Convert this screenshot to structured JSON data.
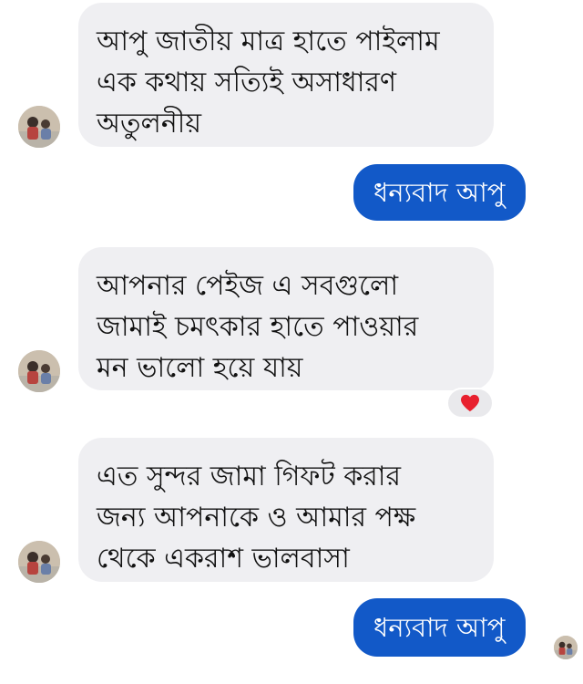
{
  "colors": {
    "incoming_bubble": "#efeff2",
    "outgoing_bubble": "#1259c8",
    "reaction_heart": "#e8202e"
  },
  "messages": [
    {
      "direction": "incoming",
      "lines": [
        "আপু জাতীয় মাত্র হাতে পাইলাম",
        "এক কথায় সত্যিই অসাধারণ",
        "অতুলনীয়"
      ]
    },
    {
      "direction": "outgoing",
      "text": "ধন্যবাদ আপু"
    },
    {
      "direction": "incoming",
      "lines": [
        "আপনার পেইজ এ সবগুলো",
        "জামাই চমৎকার হাতে পাওয়ার",
        "মন ভালো হয়ে যায়"
      ],
      "reaction": "heart-icon"
    },
    {
      "direction": "incoming",
      "lines": [
        "এত সুন্দর জামা গিফট করার",
        "জন্য আপনাকে ও আমার পক্ষ",
        "থেকে একরাশ ভালবাসা"
      ]
    },
    {
      "direction": "outgoing",
      "text": "ধন্যবাদ আপু",
      "seen_avatar": true
    }
  ]
}
